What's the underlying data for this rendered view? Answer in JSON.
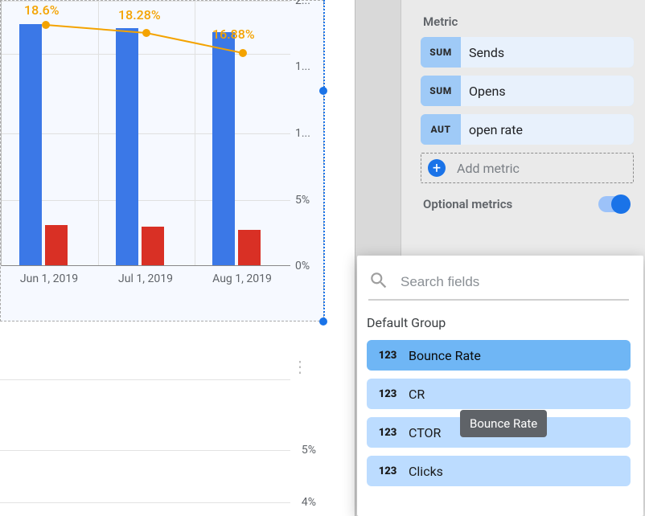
{
  "chart_data": [
    {
      "type": "bar+line",
      "categories": [
        "Jun 1, 2019",
        "Jul 1, 2019",
        "Aug 1, 2019"
      ],
      "series": [
        {
          "name": "Sends",
          "type": "bar",
          "color": "#3b78e7",
          "values": [
            185000,
            182000,
            180000
          ]
        },
        {
          "name": "Opens",
          "type": "bar",
          "color": "#d93025",
          "values": [
            34000,
            33000,
            30000
          ]
        },
        {
          "name": "open rate",
          "type": "line",
          "color": "#f4a300",
          "values": [
            18.6,
            18.28,
            16.88
          ],
          "data_labels": [
            "18.6%",
            "18.28%",
            "16.88%"
          ]
        }
      ],
      "y_axis_primary": {
        "label": "",
        "ticks": [
          "2...",
          "1...",
          "1...",
          "5%",
          "0%"
        ]
      },
      "note": "primary y tick labels are clipped in source screenshot"
    },
    {
      "type": "line",
      "categories": [],
      "series": [],
      "y_axis_primary": {
        "ticks": [
          "5%",
          "4%"
        ]
      },
      "title": ""
    }
  ],
  "sidebar": {
    "section_metric": "Metric",
    "metrics": [
      {
        "badge": "SUM",
        "label": "Sends"
      },
      {
        "badge": "SUM",
        "label": "Opens"
      },
      {
        "badge": "AUT",
        "label": "open rate"
      }
    ],
    "add_metric": "Add metric",
    "optional_metrics": "Optional metrics",
    "optional_toggle_on": true
  },
  "fields_popover": {
    "search_placeholder": "Search fields",
    "group_title": "Default Group",
    "items": [
      {
        "badge": "123",
        "label": "Bounce Rate",
        "selected": true
      },
      {
        "badge": "123",
        "label": "CR"
      },
      {
        "badge": "123",
        "label": "CTOR"
      },
      {
        "badge": "123",
        "label": "Clicks"
      }
    ],
    "tooltip": "Bounce Rate"
  }
}
